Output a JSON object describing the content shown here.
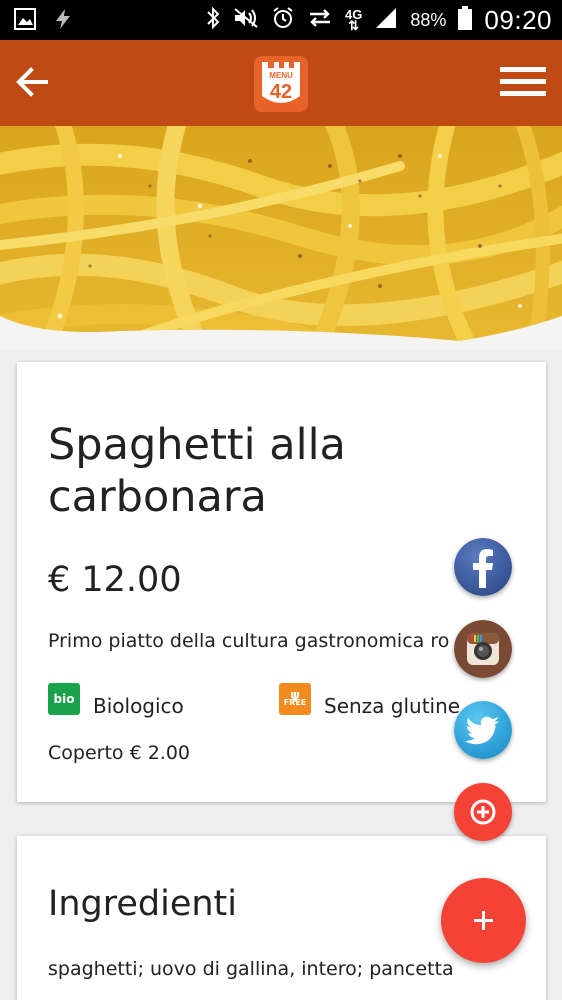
{
  "status_bar": {
    "network": "4G",
    "battery": "88%",
    "time": "09:20"
  },
  "app_bar": {
    "logo_text_top": "MENU",
    "logo_text_number": "42"
  },
  "dish": {
    "title": "Spaghetti alla carbonara",
    "price": "€ 12.00",
    "description": "Primo piatto della cultura gastronomica ro",
    "tags": [
      {
        "icon_text": "bio",
        "label": "Biologico",
        "color": "#1aa34a"
      },
      {
        "icon_text": "FREE",
        "label": "Senza glutine",
        "color": "#f28a1e"
      }
    ],
    "cover_charge": "Coperto € 2.00"
  },
  "ingredients": {
    "title": "Ingredienti",
    "text": "spaghetti; uovo di gallina, intero; pancetta"
  },
  "colors": {
    "app_bar": "#bf4a14",
    "fab": "#f44336",
    "facebook": "#3b5998",
    "twitter": "#29a9e1"
  }
}
